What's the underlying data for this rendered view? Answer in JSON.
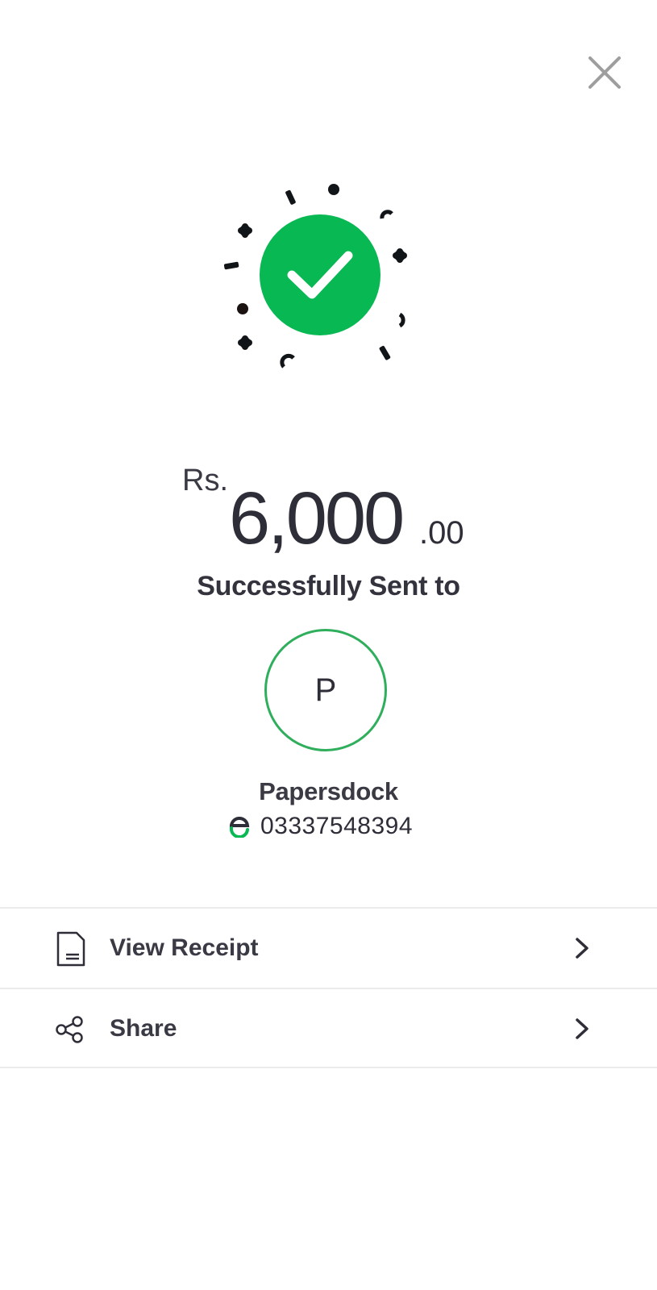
{
  "icons": {
    "close": "close-icon",
    "success": "check-circle-icon",
    "wallet": "easypaisa-e-icon",
    "receipt": "receipt-icon",
    "share": "share-icon",
    "chevron": "chevron-right-icon"
  },
  "colors": {
    "accent_green": "#07B853",
    "avatar_border": "#2FAE5C",
    "text_dark": "#2E2E38",
    "divider": "#EBEBEB",
    "close_gray": "#9E9E9E"
  },
  "transaction": {
    "currency": "Rs.",
    "amount_whole": "6,000",
    "amount_decimal": ".00",
    "status_text": "Successfully Sent to"
  },
  "recipient": {
    "initial": "P",
    "name": "Papersdock",
    "number": "03337548394"
  },
  "actions": [
    {
      "label": "View Receipt",
      "icon": "receipt-icon"
    },
    {
      "label": "Share",
      "icon": "share-icon"
    }
  ]
}
